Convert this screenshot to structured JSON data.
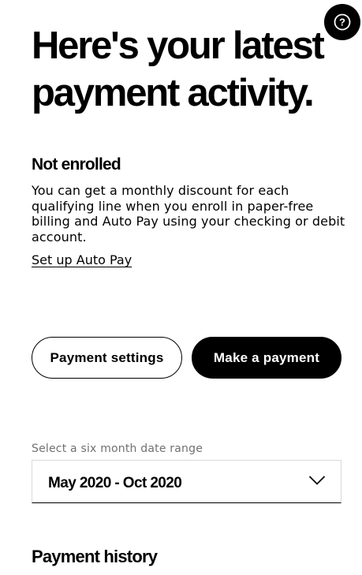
{
  "help": {
    "icon": "question-mark-icon",
    "glyph": "?"
  },
  "headline": "Here's your latest payment activity.",
  "autopay": {
    "status_title": "Not enrolled",
    "description": "You can get a monthly discount for each qualifying line when you enroll in paper-free billing and Auto Pay using your checking or debit account.",
    "link_label": "Set up Auto Pay"
  },
  "actions": {
    "payment_settings_label": "Payment settings",
    "make_payment_label": "Make a payment"
  },
  "date_range": {
    "label": "Select a six month date range",
    "selected_value": "May 2020 - Oct 2020",
    "icon": "chevron-down-icon"
  },
  "payment_history": {
    "title": "Payment history"
  },
  "colors": {
    "text": "#000000",
    "background": "#ffffff",
    "muted_label": "#6f7171",
    "field_border": "#d8dada"
  }
}
